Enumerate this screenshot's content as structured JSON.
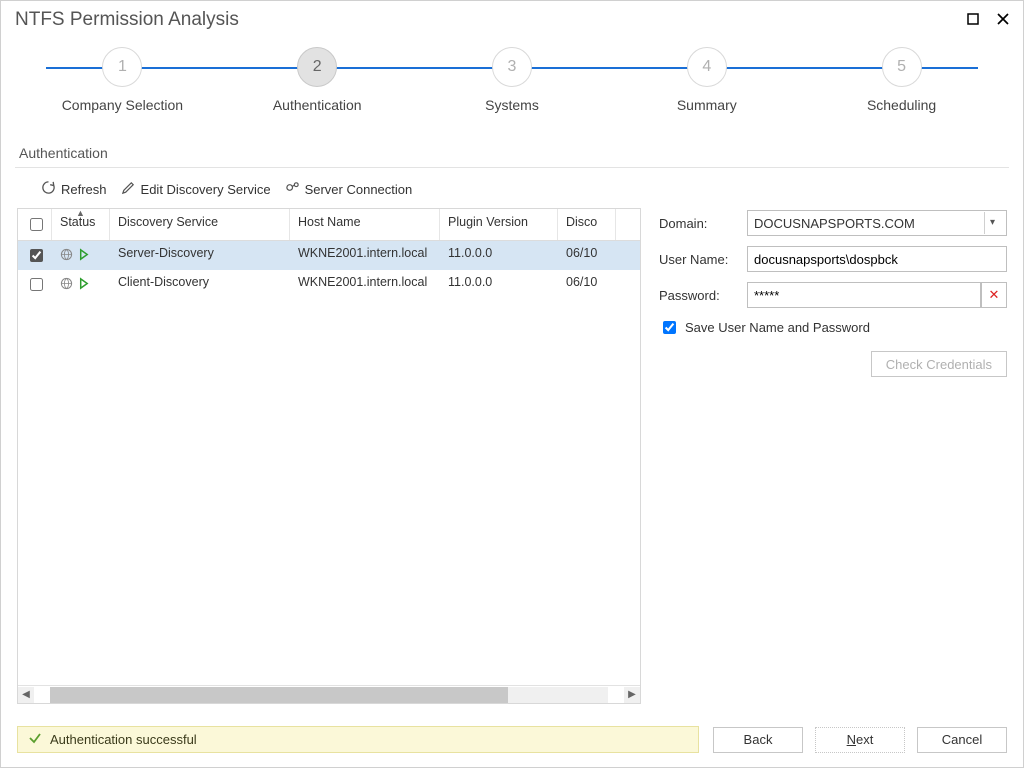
{
  "window": {
    "title": "NTFS Permission Analysis"
  },
  "wizard": {
    "steps": [
      {
        "num": "1",
        "label": "Company Selection"
      },
      {
        "num": "2",
        "label": "Authentication"
      },
      {
        "num": "3",
        "label": "Systems"
      },
      {
        "num": "4",
        "label": "Summary"
      },
      {
        "num": "5",
        "label": "Scheduling"
      }
    ],
    "active_index": 1
  },
  "section_label": "Authentication",
  "toolbar": {
    "refresh": "Refresh",
    "edit": "Edit Discovery Service",
    "server_conn": "Server Connection"
  },
  "table": {
    "headers": {
      "checkbox": "",
      "status": "Status",
      "service": "Discovery Service",
      "host": "Host Name",
      "plugin": "Plugin Version",
      "disco": "Disco"
    },
    "rows": [
      {
        "checked": true,
        "service": "Server-Discovery",
        "host": "WKNE2001.intern.local",
        "plugin": "11.0.0.0",
        "disco": "06/10"
      },
      {
        "checked": false,
        "service": "Client-Discovery",
        "host": "WKNE2001.intern.local",
        "plugin": "11.0.0.0",
        "disco": "06/10"
      }
    ]
  },
  "form": {
    "domain_label": "Domain:",
    "domain_value": "DOCUSNAPSPORTS.COM",
    "user_label": "User Name:",
    "user_value": "docusnapsports\\dospbck",
    "password_label": "Password:",
    "password_value": "*****",
    "save_label": "Save User Name and Password",
    "save_checked": true,
    "check_credentials": "Check Credentials"
  },
  "status": {
    "text": "Authentication successful"
  },
  "buttons": {
    "back": "Back",
    "next": "Next",
    "cancel": "Cancel"
  }
}
